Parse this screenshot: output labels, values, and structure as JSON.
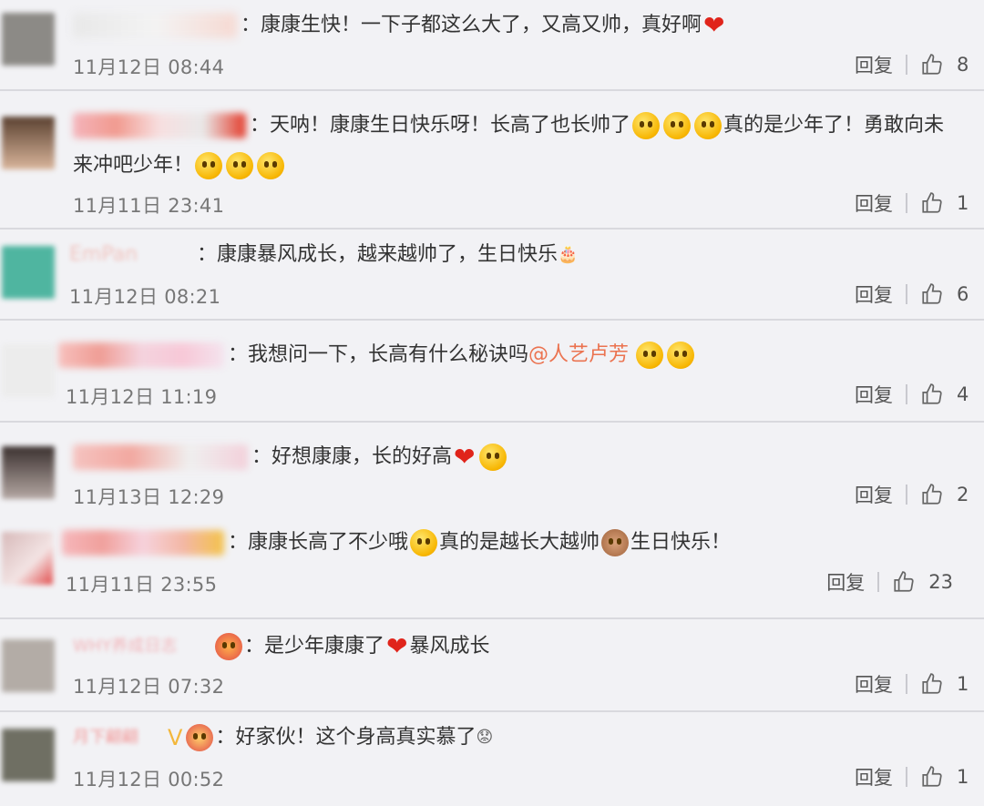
{
  "comments": [
    {
      "text": "康康生快！一下子都这么大了，又高又帅，真好啊",
      "emoji_after": [
        "heart"
      ],
      "time": "11月12日 08:44",
      "reply": "回复",
      "likes": "8",
      "avatar_color": "#8c8a86"
    },
    {
      "text": "天呐！康康生日快乐呀！长高了也长帅了",
      "text2": "真的是少年了！勇敢向未",
      "text3": "来冲吧少年！",
      "time": "11月11日 23:41",
      "reply": "回复",
      "likes": "1",
      "avatar_color": "#9b7b64"
    },
    {
      "username": "EmPan",
      "text": "康康暴风成长，越来越帅了，生日快乐",
      "time": "11月12日 08:21",
      "reply": "回复",
      "likes": "6",
      "avatar_color": "#4fb5a0"
    },
    {
      "text": "我想问一下，长高有什么秘诀吗",
      "mention": "@人艺卢芳",
      "time": "11月12日 11:19",
      "reply": "回复",
      "likes": "4",
      "avatar_color": "#e6e6e6"
    },
    {
      "text": "好想康康，长的好高",
      "time": "11月13日 12:29",
      "reply": "回复",
      "likes": "2",
      "avatar_color": "#6b5a55"
    },
    {
      "text": "康康长高了不少哦",
      "text2": "真的是越长大越帅",
      "text3": "生日快乐！",
      "time": "11月11日 23:55",
      "reply": "回复",
      "likes": "23",
      "avatar_color": "#c9a7a7"
    },
    {
      "username": "WHY养成日志",
      "text": "是少年康康了",
      "text2": "暴风成长",
      "time": "11月12日 07:32",
      "reply": "回复",
      "likes": "1",
      "avatar_color": "#b3aca6"
    },
    {
      "username": "月下翩翩",
      "text": "好家伙！这个身高真实慕了",
      "time": "11月12日 00:52",
      "reply": "回复",
      "likes": "1",
      "avatar_color": "#6f6f63"
    }
  ]
}
